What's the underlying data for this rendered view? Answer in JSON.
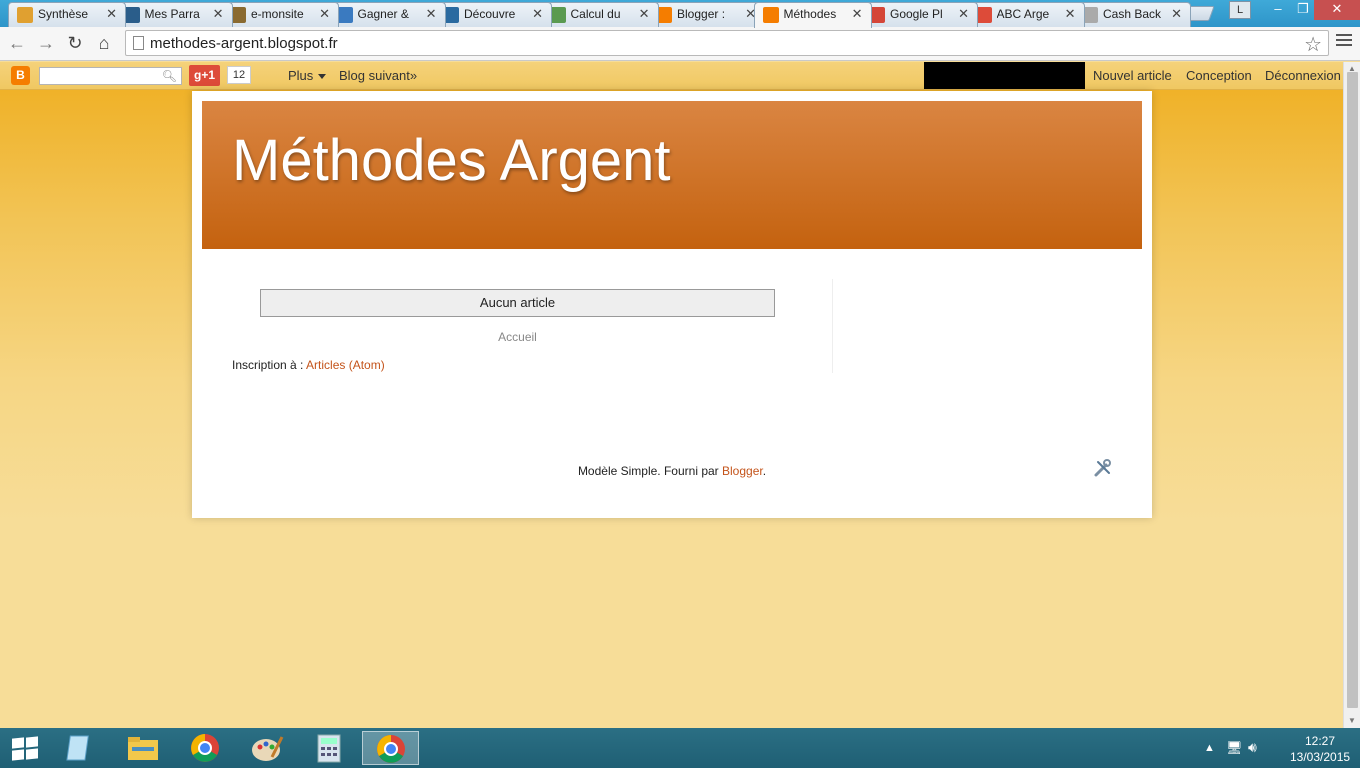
{
  "browser": {
    "tabs": [
      {
        "title": "Synthèse",
        "favicon": "chart-icon",
        "color": "#e0a030"
      },
      {
        "title": "Mes Parra",
        "favicon": "g-icon",
        "color": "#2a5d8a"
      },
      {
        "title": "e-monsite",
        "favicon": "brush-icon",
        "color": "#8a6a30"
      },
      {
        "title": "Gagner &",
        "favicon": "runner-icon",
        "color": "#3a7ac0"
      },
      {
        "title": "Découvre",
        "favicon": "circle-icon",
        "color": "#2a6aa0"
      },
      {
        "title": "Calcul du",
        "favicon": "bird-icon",
        "color": "#5a9a50"
      },
      {
        "title": "Blogger :",
        "favicon": "blogger-icon",
        "color": "#f57d00"
      },
      {
        "title": "Méthodes",
        "favicon": "blogger-icon",
        "color": "#f57d00"
      },
      {
        "title": "Google Pl",
        "favicon": "gmail-icon",
        "color": "#d44638"
      },
      {
        "title": "ABC Arge",
        "favicon": "gplus-icon",
        "color": "#dd4b39"
      },
      {
        "title": "Cash Back",
        "favicon": "page-icon",
        "color": "#aaaaaa"
      }
    ],
    "active_tab_index": 7,
    "profile_initial": "L",
    "url": "methodes-argent.blogspot.fr"
  },
  "navbar": {
    "gplus_label": "g+1",
    "gplus_count": "12",
    "more_label": "Plus",
    "next_blog_label": "Blog suivant»",
    "new_post_label": "Nouvel article",
    "design_label": "Conception",
    "logout_label": "Déconnexion"
  },
  "blog": {
    "title": "Méthodes Argent",
    "no_posts_label": "Aucun article",
    "home_label": "Accueil",
    "subscribe_label": "Inscription à : ",
    "subscribe_link": "Articles (Atom)",
    "footer_label": "Modèle Simple. Fourni par ",
    "footer_link": "Blogger",
    "footer_end": "."
  },
  "taskbar": {
    "time": "12:27",
    "date": "13/03/2015"
  },
  "colors": {
    "accent": "#c4541b",
    "header_top": "#da8542",
    "header_bottom": "#c4620f",
    "page_bg_top": "#efae1f",
    "page_bg_bottom": "#f7dd98"
  }
}
